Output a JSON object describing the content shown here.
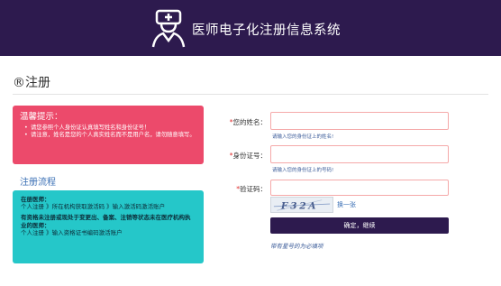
{
  "header": {
    "title": "医师电子化注册信息系统",
    "logo_icon": "doctor-icon"
  },
  "page": {
    "title": "®注册"
  },
  "tip": {
    "title": "温馨提示：",
    "items": [
      "请您参照个人身份证认真填写姓名和身份证号！",
      "请注意，姓名是您的个人真实姓名而不是用户名，请勿随意填写。"
    ]
  },
  "flow": {
    "title": "注册流程",
    "block1_title": "在册医师：",
    "block1_text": "个人注册 》所在机构获取激活码 》输入激活码激活账户",
    "block2_title": "有资格未注册或现处于变更出、备案、注销等状态未在医疗机构执业的医师：",
    "block2_text": "个人注册 》输入资格证书编码激活账户"
  },
  "form": {
    "name_label": "您的姓名：",
    "name_hint": "请输入您的身份证上的姓名!",
    "id_label": "身份证号：",
    "id_hint": "请输入您的身份证上的号码!",
    "captcha_label": "验证码：",
    "captcha_text": "F32A",
    "refresh_label": "换一张",
    "submit_label": "确定，继续",
    "required_note": "带有星号的为必填项"
  },
  "colors": {
    "header": "#2d1a4e",
    "tip": "#ec4a6b",
    "info": "#25c7c9",
    "button": "#2d1a4e"
  }
}
